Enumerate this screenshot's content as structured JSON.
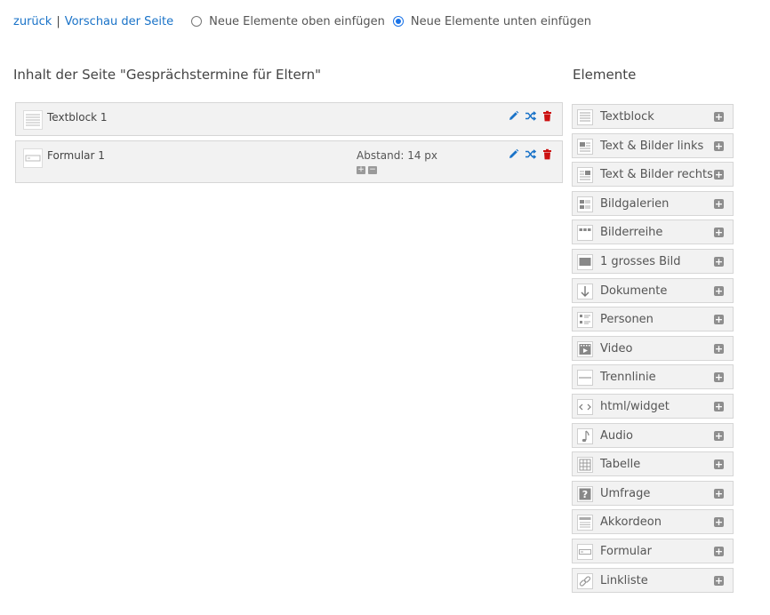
{
  "topbar": {
    "back_link": "zurück",
    "separator": "|",
    "preview_link": "Vorschau der Seite",
    "radio_top_label": "Neue Elemente oben einfügen",
    "radio_bottom_label": "Neue Elemente unten einfügen",
    "selected": "bottom"
  },
  "content": {
    "heading": "Inhalt der Seite \"Gesprächstermine für Eltern\"",
    "items": [
      {
        "label": "Textblock 1",
        "icon": "textblock-icon"
      },
      {
        "label": "Formular 1",
        "icon": "formular-icon",
        "spacing_label": "Abstand: 14 px"
      }
    ]
  },
  "elements": {
    "heading": "Elemente",
    "items": [
      {
        "label": "Textblock",
        "icon": "textblock-icon"
      },
      {
        "label": "Text & Bilder links",
        "icon": "text-images-left-icon"
      },
      {
        "label": "Text & Bilder rechts",
        "icon": "text-images-right-icon"
      },
      {
        "label": "Bildgalerien",
        "icon": "gallery-icon"
      },
      {
        "label": "Bilderreihe",
        "icon": "image-row-icon"
      },
      {
        "label": "1 grosses Bild",
        "icon": "large-image-icon"
      },
      {
        "label": "Dokumente",
        "icon": "download-icon"
      },
      {
        "label": "Personen",
        "icon": "persons-icon"
      },
      {
        "label": "Video",
        "icon": "video-icon"
      },
      {
        "label": "Trennlinie",
        "icon": "divider-icon"
      },
      {
        "label": "html/widget",
        "icon": "code-icon"
      },
      {
        "label": "Audio",
        "icon": "music-note-icon"
      },
      {
        "label": "Tabelle",
        "icon": "table-icon"
      },
      {
        "label": "Umfrage",
        "icon": "question-icon"
      },
      {
        "label": "Akkordeon",
        "icon": "accordion-icon"
      },
      {
        "label": "Formular",
        "icon": "form-icon"
      },
      {
        "label": "Linkliste",
        "icon": "link-icon"
      }
    ]
  },
  "colors": {
    "link": "#1a73c8",
    "edit": "#1a73c8",
    "delete": "#cc1111",
    "add": "#8e8e8e"
  }
}
